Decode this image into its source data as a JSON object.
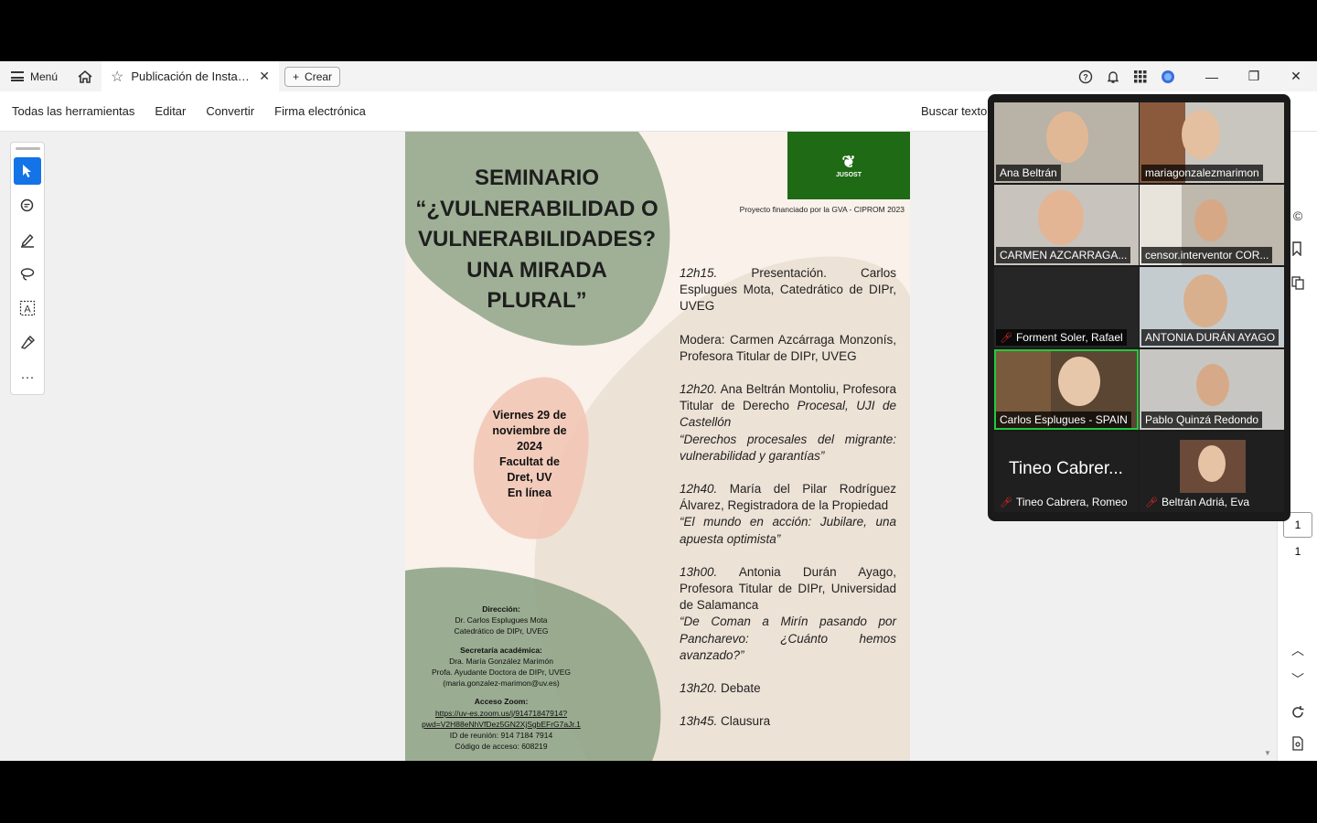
{
  "titlebar": {
    "menu_label": "Menú",
    "tab_label": "Publicación de Instag...",
    "create_label": "Crear"
  },
  "toolbar": {
    "items": [
      "Todas las herramientas",
      "Editar",
      "Convertir",
      "Firma electrónica"
    ],
    "search_text": "Buscar texto"
  },
  "document": {
    "logo_text": "JUSOST",
    "funded_by": "Proyecto financiado por la GVA - CIPROM 2023",
    "title_lines": [
      "SEMINARIO",
      "“¿VULNERABILIDAD O",
      "VULNERABILIDADES?",
      "UNA MIRADA",
      "PLURAL”"
    ],
    "date_lines": [
      "Viernes 29 de",
      "noviembre de",
      "2024",
      "Facultat de",
      "Dret, UV",
      "En línea"
    ],
    "program": [
      {
        "time": "12h15.",
        "text": " Presentación. Carlos Esplugues Mota, Catedrático de DIPr, UVEG",
        "talk": ""
      },
      {
        "time": "",
        "text": "Modera: Carmen Azcárraga Monzonís, Profesora Titular de DIPr, UVEG",
        "talk": ""
      },
      {
        "time": "12h20.",
        "text": " Ana Beltrán Montoliu, Profesora Titular de Derecho ",
        "talk": "Procesal, UJI de Castellón",
        "quote": "“Derechos procesales del migrante: vulnerabilidad y garantías”"
      },
      {
        "time": "12h40.",
        "text": " María del Pilar Rodríguez Álvarez, Registradora de la Propiedad",
        "talk": "",
        "quote": "“El mundo en acción: Jubilare, una apuesta optimista”"
      },
      {
        "time": "13h00.",
        "text": " Antonia Durán Ayago, Profesora Titular de DIPr, Universidad de Salamanca",
        "talk": "",
        "quote": "“De Coman a Mirín pasando por Pancharevo: ¿Cuánto hemos avanzado?”"
      },
      {
        "time": "13h20.",
        "text": "  Debate",
        "talk": ""
      },
      {
        "time": "13h45.",
        "text": " Clausura",
        "talk": ""
      }
    ],
    "info": {
      "direccion_hd": "Dirección:",
      "direccion_1": "Dr. Carlos Esplugues Mota",
      "direccion_2": "Catedrático de DIPr, UVEG",
      "secretaria_hd": "Secretaría académica:",
      "secretaria_1": "Dra. María González Marimón",
      "secretaria_2": "Profa. Ayudante Doctora de DIPr, UVEG",
      "secretaria_3": "(maria.gonzalez-marimon@uv.es)",
      "zoom_hd": "Acceso Zoom:",
      "zoom_link_1": "https://uv-es.zoom.us/j/91471847914?",
      "zoom_link_2": "pwd=V2H88eNhVfDez5GN2XjSgbEFrG7aJr.1",
      "meeting_id": "ID de reunión: 914 7184 7914",
      "access_code": "Código de acceso: 608219"
    }
  },
  "zoom_participants": [
    {
      "name": "Ana Beltrán",
      "muted": false
    },
    {
      "name": "mariagonzalezmarimon",
      "muted": false
    },
    {
      "name": "CARMEN AZCARRAGA...",
      "muted": false
    },
    {
      "name": "censor.interventor COR...",
      "muted": false
    },
    {
      "name": "Forment Soler, Rafael",
      "muted": true
    },
    {
      "name": "ANTONIA DURÁN AYAGO",
      "muted": false
    },
    {
      "name": "Carlos Esplugues - SPAIN",
      "muted": false
    },
    {
      "name": "Pablo Quinzá Redondo",
      "muted": false
    },
    {
      "name": "Tineo Cabrera, Romeo",
      "muted": true,
      "big_label": "Tineo Cabrer..."
    },
    {
      "name": "Beltrán Adriá, Eva",
      "muted": true
    }
  ],
  "rail": {
    "page_current": "1",
    "page_total": "1"
  },
  "colors": {
    "accent": "#1473e6",
    "sage": "#8fa487",
    "pink": "#f2c7b6",
    "logo_green": "#1f6a14",
    "active_speaker": "#24c93d"
  }
}
